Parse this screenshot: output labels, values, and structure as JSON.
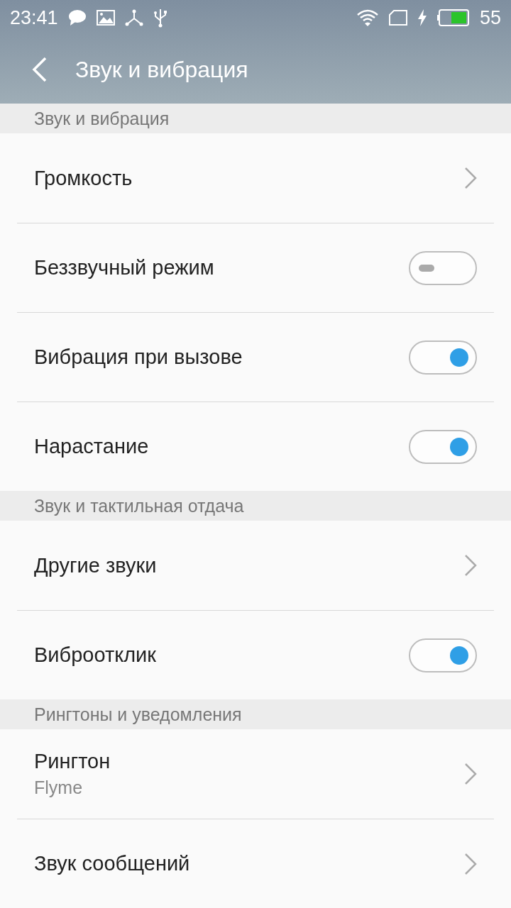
{
  "status_bar": {
    "time": "23:41",
    "battery": "55"
  },
  "toolbar": {
    "title": "Звук и вибрация"
  },
  "sections": [
    {
      "header": "Звук и вибрация",
      "items": [
        {
          "kind": "link",
          "label": "Громкость"
        },
        {
          "kind": "switch",
          "label": "Беззвучный режим",
          "on": false
        },
        {
          "kind": "switch",
          "label": "Вибрация при вызове",
          "on": true
        },
        {
          "kind": "switch",
          "label": "Нарастание",
          "on": true
        }
      ]
    },
    {
      "header": "Звук и тактильная отдача",
      "items": [
        {
          "kind": "link",
          "label": "Другие звуки"
        },
        {
          "kind": "switch",
          "label": "Виброотклик",
          "on": true
        }
      ]
    },
    {
      "header": "Рингтоны и уведомления",
      "items": [
        {
          "kind": "link",
          "label": "Рингтон",
          "value": "Flyme"
        },
        {
          "kind": "link",
          "label": "Звук сообщений"
        }
      ]
    }
  ]
}
